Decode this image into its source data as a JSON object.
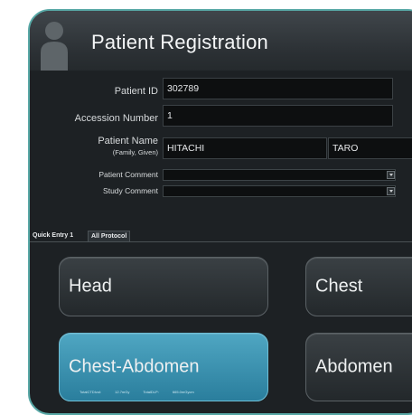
{
  "header": {
    "title": "Patient Registration"
  },
  "form": {
    "patient_id": {
      "label": "Patient ID",
      "value": "302789"
    },
    "accession_number": {
      "label": "Accession Number",
      "value": "1"
    },
    "patient_name": {
      "label": "Patient Name",
      "sublabel": "(Family, Given)",
      "family": "HITACHI",
      "given": "TARO"
    },
    "patient_comment": {
      "label": "Patient Comment",
      "value": ""
    },
    "study_comment": {
      "label": "Study Comment",
      "value": ""
    }
  },
  "tabs": [
    {
      "label": "Quick Entry 1"
    },
    {
      "label": "All Protocol"
    }
  ],
  "protocols": [
    {
      "label": "Head",
      "active": false
    },
    {
      "label": "Chest",
      "active": false
    },
    {
      "label": "Chest-Abdomen",
      "active": true,
      "stats": [
        "TotalCTDIvol:",
        "12.7mGy",
        "TotalDLP:",
        "665.0mGycm"
      ]
    },
    {
      "label": "Abdomen",
      "active": false
    }
  ],
  "colors": {
    "frame": "#58a8a6",
    "active_button": "#3e94b3",
    "background": "#1d2124"
  }
}
